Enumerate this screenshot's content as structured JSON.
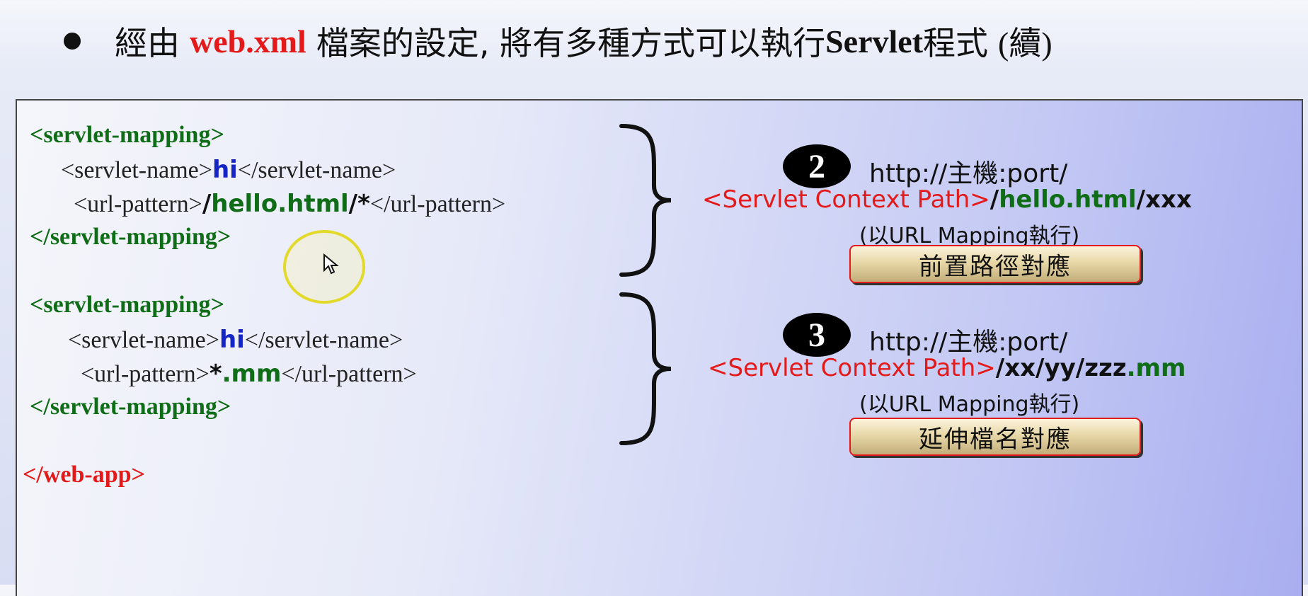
{
  "title": {
    "prefix": "經由",
    "highlight": "web.xml",
    "middle": "檔案的設定, 將有多種方式可以執行",
    "servlet": "Servlet",
    "suffix": "程式",
    "paren": "(續)"
  },
  "block1": {
    "open_tag": "<servlet-mapping>",
    "name_open": "<servlet-name>",
    "name_value": "hi",
    "name_close": "</servlet-name>",
    "pattern_open": "<url-pattern>",
    "pattern_slash1": "/",
    "pattern_value": "hello.html",
    "pattern_slash2": "/*",
    "pattern_close": "</url-pattern>",
    "close_tag": "</servlet-mapping>"
  },
  "block2": {
    "open_tag": "<servlet-mapping>",
    "name_open": "<servlet-name>",
    "name_value": "hi",
    "name_close": "</servlet-name>",
    "pattern_open": "<url-pattern>",
    "pattern_star": "*",
    "pattern_ext": ".mm",
    "pattern_close": "</url-pattern>",
    "close_tag": "</servlet-mapping>"
  },
  "end_tag": "</web-app>",
  "item2": {
    "number": "2",
    "url_line1": "http://主機:port/",
    "context": "<Servlet Context Path>",
    "slash_a": "/",
    "path": "hello.html",
    "slash_b": "/",
    "tail": "xxx",
    "note": "(以URL Mapping執行)",
    "badge": "前置路徑對應"
  },
  "item3": {
    "number": "3",
    "url_line1": "http://主機:port/",
    "context": "<Servlet Context Path>",
    "path": "/xx/yy/",
    "file": "zzz",
    "ext": ".mm",
    "note": "(以URL Mapping執行)",
    "badge": "延伸檔名對應"
  }
}
